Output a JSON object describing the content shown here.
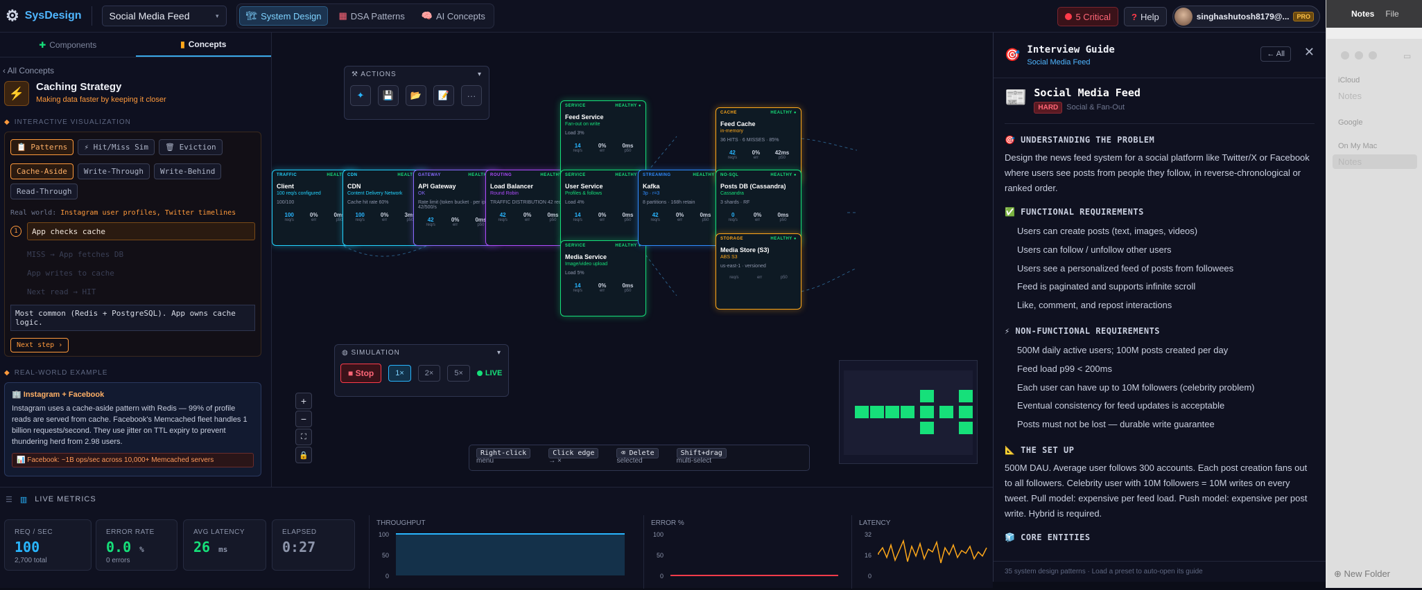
{
  "topbar": {
    "app_name": "SysDesign",
    "design_select": "Social Media Feed",
    "nav": [
      {
        "label": "System Design",
        "icon": "🏗"
      },
      {
        "label": "DSA Patterns",
        "icon": "▦"
      },
      {
        "label": "AI Concepts",
        "icon": "🧠"
      }
    ],
    "critical_label": "5 Critical",
    "help_label": "Help",
    "username": "singhashutosh8179@...",
    "plan_badge": "PRO"
  },
  "left": {
    "tabs": [
      "Components",
      "Concepts"
    ],
    "back": "‹ All Concepts",
    "concept_title": "Caching Strategy",
    "concept_subtitle": "Making data faster by keeping it closer",
    "section_viz": "INTERACTIVE VISUALIZATION",
    "viz_tabs": [
      "Patterns",
      "Hit/Miss Sim",
      "Eviction"
    ],
    "strategies": [
      "Cache-Aside",
      "Write-Through",
      "Write-Behind",
      "Read-Through"
    ],
    "real_world_label": "Real world:",
    "real_world_value": "Instagram user profiles, Twitter timelines",
    "steps": [
      "App checks cache",
      "MISS → App fetches DB",
      "App writes to cache",
      "Next read → HIT"
    ],
    "note": "Most common (Redis + PostgreSQL). App owns cache logic.",
    "next_step": "Next step ›",
    "section_example": "REAL-WORLD EXAMPLE",
    "example_title": "Instagram + Facebook",
    "example_text": "Instagram uses a cache-aside pattern with Redis — 99% of profile reads are served from cache. Facebook's Memcached fleet handles 1 billion requests/second. They use jitter on TTL expiry to prevent thundering herd from 2.98 users.",
    "example_chip": "Facebook: ~1B ops/sec across 10,000+ Memcached servers"
  },
  "canvas": {
    "actions_label": "ACTIONS",
    "simulation_label": "SIMULATION",
    "stop_label": "■ Stop",
    "speeds": [
      "1×",
      "2×",
      "5×"
    ],
    "live_label": "LIVE",
    "hints": [
      {
        "key": "Right-click",
        "text": "menu"
      },
      {
        "key": "Click edge",
        "text": "→ ×"
      },
      {
        "key": "⌫ Delete",
        "text": "selected"
      },
      {
        "key": "Shift+drag",
        "text": "multi-select"
      }
    ],
    "nodes": [
      {
        "kind": "TRAFFIC",
        "status": "HEALTHY",
        "title": "Client",
        "sub": "100 req/s configured",
        "color": "#23d3ff",
        "extra": "100/100",
        "stats": [
          "100",
          "0%",
          "0ms"
        ]
      },
      {
        "kind": "CDN",
        "status": "HEALTHY",
        "title": "CDN",
        "sub": "Content Delivery Network",
        "color": "#23d3ff",
        "extra": "Cache hit rate 60%",
        "stats": [
          "100",
          "0%",
          "3ms"
        ]
      },
      {
        "kind": "GATEWAY",
        "status": "HEALTHY",
        "title": "API Gateway",
        "sub": "OK",
        "color": "#8a6bff",
        "extra": "Rate limit (token bucket · per ip) 42/500/s",
        "stats": [
          "42",
          "0%",
          "0ms"
        ]
      },
      {
        "kind": "ROUTING",
        "status": "HEALTHY",
        "title": "Load Balancer",
        "sub": "Round Robin",
        "color": "#b04cff",
        "extra": "TRAFFIC DISTRIBUTION 42 req/s",
        "stats": [
          "42",
          "0%",
          "0ms"
        ]
      },
      {
        "kind": "SERVICE",
        "status": "HEALTHY",
        "title": "Feed Service",
        "sub": "Fan-out on write",
        "color": "#16e07a",
        "extra": "Load 3%",
        "stats": [
          "14",
          "0%",
          "0ms"
        ]
      },
      {
        "kind": "SERVICE",
        "status": "HEALTHY",
        "title": "User Service",
        "sub": "Profiles & follows",
        "color": "#16e07a",
        "extra": "Load 4%",
        "stats": [
          "14",
          "0%",
          "0ms"
        ]
      },
      {
        "kind": "SERVICE",
        "status": "HEALTHY",
        "title": "Media Service",
        "sub": "Image/video upload",
        "color": "#16e07a",
        "extra": "Load 5%",
        "stats": [
          "14",
          "0%",
          "0ms"
        ]
      },
      {
        "kind": "STREAMING",
        "status": "HEALTHY",
        "title": "Kafka",
        "sub": "3p · r=3",
        "color": "#2f8bff",
        "extra": "8 partitions · 168h retain",
        "stats": [
          "42",
          "0%",
          "0ms"
        ]
      },
      {
        "kind": "CACHE",
        "status": "HEALTHY",
        "title": "Feed Cache",
        "sub": "in-memory",
        "color": "#ffa81a",
        "extra": "36 HITS · 6 MISSES · 85%",
        "stats": [
          "42",
          "0%",
          "42ms"
        ]
      },
      {
        "kind": "NO-SQL",
        "status": "HEALTHY",
        "title": "Posts DB (Cassandra)",
        "sub": "Cassandra",
        "color": "#16e07a",
        "extra": "3 shards · RF",
        "stats": [
          "0",
          "0%",
          "0ms"
        ]
      },
      {
        "kind": "STORAGE",
        "status": "HEALTHY",
        "title": "Media Store (S3)",
        "sub": "ABS S3",
        "color": "#ffa81a",
        "extra": "us-east-1 · versioned",
        "stats": [
          "",
          "",
          ""
        ]
      }
    ]
  },
  "metrics": {
    "header": "LIVE METRICS",
    "cards": [
      {
        "label": "REQ / SEC",
        "value": "100",
        "unit": "",
        "sub": "2,700 total",
        "color": "#29b6ff"
      },
      {
        "label": "ERROR RATE",
        "value": "0.0",
        "unit": "%",
        "sub": "0 errors",
        "color": "#16e07a"
      },
      {
        "label": "AVG LATENCY",
        "value": "26",
        "unit": "ms",
        "sub": "",
        "color": "#16e07a"
      },
      {
        "label": "ELAPSED",
        "value": "0:27",
        "unit": "",
        "sub": "",
        "color": "#8d95ab"
      }
    ],
    "throughput": {
      "label": "THROUGHPUT",
      "ticks": [
        "100",
        "50",
        "0"
      ],
      "color": "#29b6ff"
    },
    "errors": {
      "label": "ERROR %",
      "ticks": [
        "100",
        "50",
        "0"
      ],
      "color": "#ff3b4a"
    },
    "latency": {
      "label": "LATENCY",
      "ticks": [
        "32",
        "16",
        "0"
      ],
      "color": "#ffa81a"
    }
  },
  "guide": {
    "title": "Interview Guide",
    "subtitle": "Social Media Feed",
    "all_button": "← All",
    "problem_title": "Social Media Feed",
    "difficulty": "HARD",
    "tag": "Social & Fan-Out",
    "sections": [
      {
        "icon": "🎯",
        "heading": "UNDERSTANDING THE PROBLEM",
        "paragraph": "Design the news feed system for a social platform like Twitter/X or Facebook where users see posts from people they follow, in reverse-chronological or ranked order."
      },
      {
        "icon": "✅",
        "heading": "FUNCTIONAL REQUIREMENTS",
        "items": [
          "Users can create posts (text, images, videos)",
          "Users can follow / unfollow other users",
          "Users see a personalized feed of posts from followees",
          "Feed is paginated and supports infinite scroll",
          "Like, comment, and repost interactions"
        ]
      },
      {
        "icon": "⚡",
        "heading": "NON-FUNCTIONAL REQUIREMENTS",
        "items": [
          "500M daily active users; 100M posts created per day",
          "Feed load p99 < 200ms",
          "Each user can have up to 10M followers (celebrity problem)",
          "Eventual consistency for feed updates is acceptable",
          "Posts must not be lost — durable write guarantee"
        ]
      },
      {
        "icon": "📐",
        "heading": "THE SET UP",
        "paragraph": "500M DAU. Average user follows 300 accounts. Each post creation fans out to all followers. Celebrity user with 10M followers = 10M writes on every tweet. Pull model: expensive per feed load. Push model: expensive per post write. Hybrid is required."
      },
      {
        "icon": "🧊",
        "heading": "CORE ENTITIES"
      }
    ],
    "footer": "35 system design patterns · Load a preset to auto-open its guide"
  },
  "notes_app": {
    "menu": [
      "Notes",
      "File"
    ],
    "groups": [
      {
        "name": "iCloud",
        "items": [
          "Notes"
        ]
      },
      {
        "name": "Google",
        "items": []
      },
      {
        "name": "On My Mac",
        "items": [
          "Notes"
        ]
      }
    ],
    "new_folder": "New Folder"
  }
}
